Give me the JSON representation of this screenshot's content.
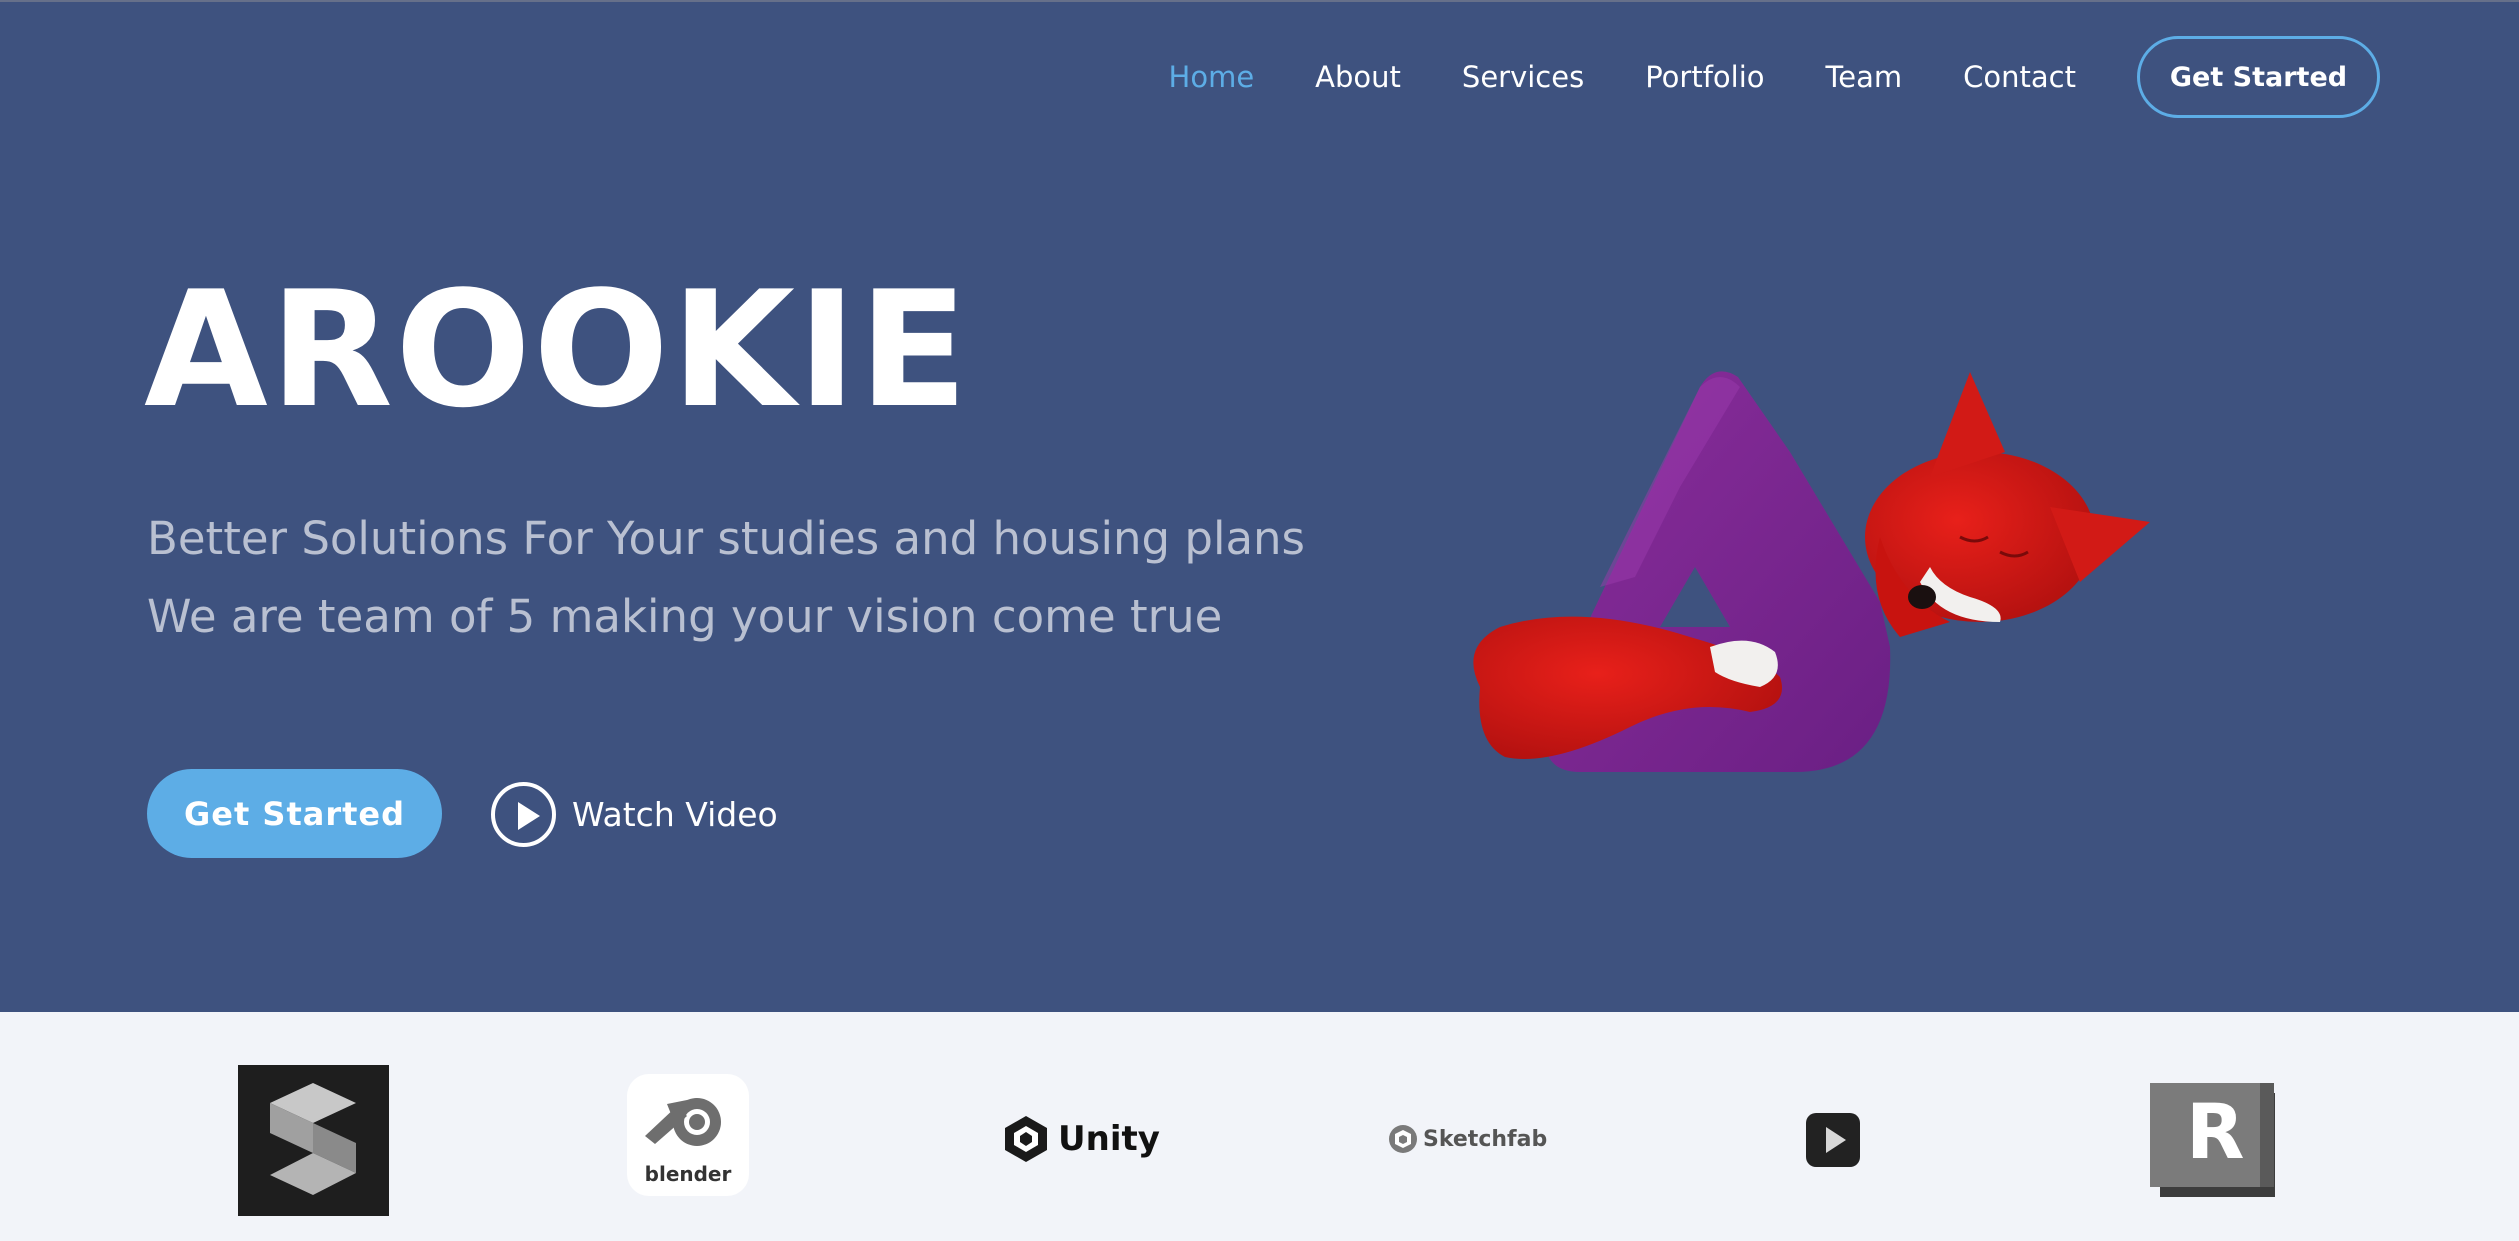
{
  "nav": {
    "items": [
      {
        "label": "Home",
        "active": true
      },
      {
        "label": "About",
        "active": false
      },
      {
        "label": "Services",
        "active": false
      },
      {
        "label": "Portfolio",
        "active": false
      },
      {
        "label": "Team",
        "active": false
      },
      {
        "label": "Contact",
        "active": false
      }
    ],
    "cta_label": "Get Started"
  },
  "hero": {
    "title": "AROOKIE",
    "subtitle_line1": "Better Solutions For Your studies and housing plans",
    "subtitle_line2": "We are team of 5 making your vision come true",
    "cta_label": "Get Started",
    "watch_label": "Watch Video",
    "image": "purple-triangle-logo-with-red-fox-mascot"
  },
  "logos": {
    "items": [
      {
        "name": "substance-painter-logo",
        "label": ""
      },
      {
        "name": "blender-logo",
        "label": "blender"
      },
      {
        "name": "unity-logo",
        "label": "Unity"
      },
      {
        "name": "sketchfab-logo",
        "label": "Sketchfab"
      },
      {
        "name": "marmoset-logo",
        "label": ""
      },
      {
        "name": "autodesk-revit-logo",
        "label": "R"
      }
    ]
  },
  "colors": {
    "hero_bg": "#3e527f",
    "accent": "#5dade6",
    "logo_strip_bg": "#f2f4f9",
    "subtitle_text": "#b9c0d1"
  }
}
